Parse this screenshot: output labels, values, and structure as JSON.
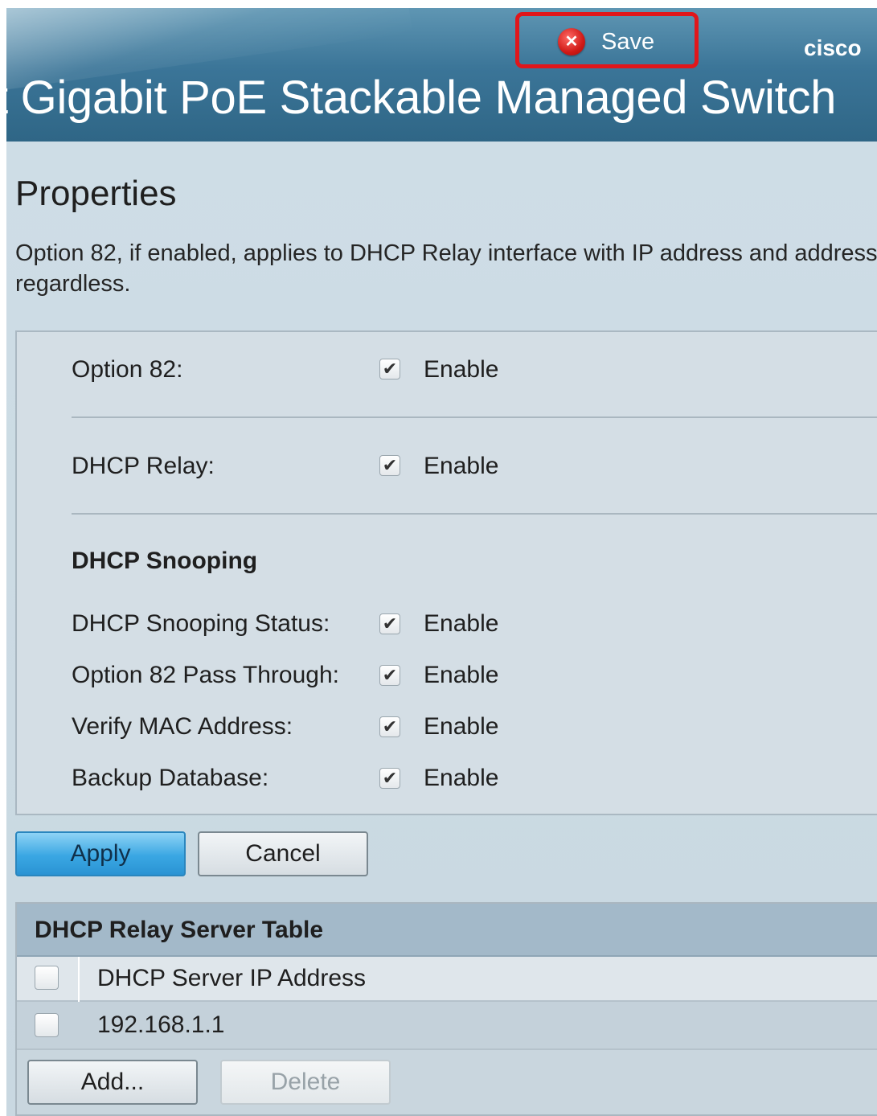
{
  "header": {
    "title": "t Gigabit PoE Stackable Managed Switch",
    "brand": "cisco",
    "save_label": "Save",
    "save_icon": "close-circle-icon"
  },
  "page": {
    "title": "Properties",
    "description": "Option 82, if enabled, applies to DHCP Relay interface with IP address and address regardless."
  },
  "settings": {
    "option82": {
      "label": "Option 82:",
      "checked": true,
      "enable_label": "Enable"
    },
    "dhcp_relay": {
      "label": "DHCP Relay:",
      "checked": true,
      "enable_label": "Enable"
    },
    "snooping_heading": "DHCP Snooping",
    "snooping_status": {
      "label": "DHCP Snooping Status:",
      "checked": true,
      "enable_label": "Enable"
    },
    "pass_through": {
      "label": "Option 82 Pass Through:",
      "checked": true,
      "enable_label": "Enable"
    },
    "verify_mac": {
      "label": "Verify MAC Address:",
      "checked": true,
      "enable_label": "Enable"
    },
    "backup_db": {
      "label": "Backup Database:",
      "checked": true,
      "enable_label": "Enable"
    }
  },
  "actions": {
    "apply": "Apply",
    "cancel": "Cancel"
  },
  "server_table": {
    "title": "DHCP Relay Server Table",
    "column": "DHCP Server IP Address",
    "rows": [
      {
        "ip": "192.168.1.1",
        "checked": false
      }
    ],
    "add_label": "Add...",
    "delete_label": "Delete"
  },
  "checkmark": "✔"
}
